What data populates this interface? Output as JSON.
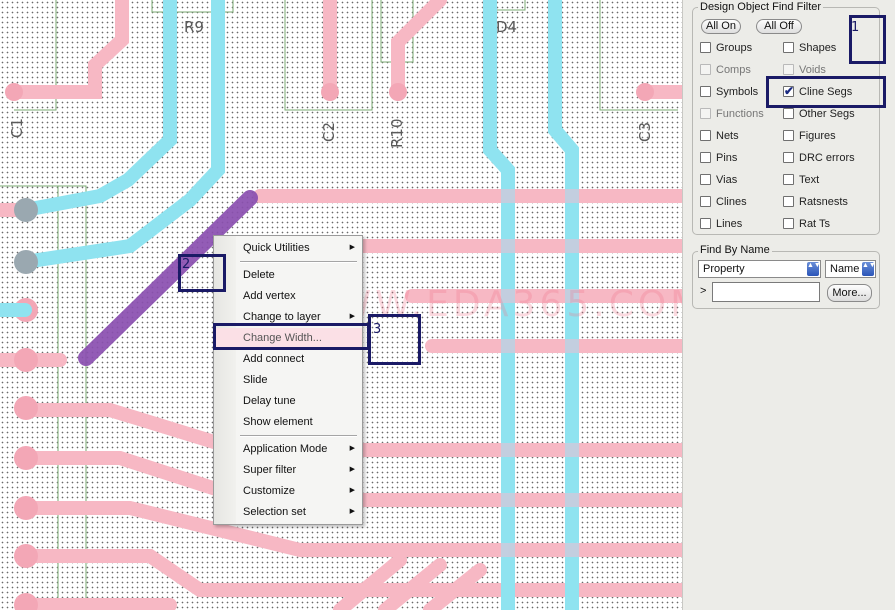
{
  "canvas": {
    "refdes": [
      "R9",
      "D4",
      "C1",
      "C2",
      "R10",
      "C3"
    ],
    "watermark": "WWW.EDA365.COM"
  },
  "context_menu": {
    "items": [
      {
        "label": "Quick Utilities",
        "submenu": true
      },
      {
        "label": "Delete",
        "submenu": false
      },
      {
        "label": "Add vertex",
        "submenu": false
      },
      {
        "label": "Change to layer",
        "submenu": true
      },
      {
        "label": "Change Width...",
        "submenu": false,
        "highlighted": true
      },
      {
        "label": "Add connect",
        "submenu": false
      },
      {
        "label": "Slide",
        "submenu": false
      },
      {
        "label": "Delay tune",
        "submenu": false
      },
      {
        "label": "Show element",
        "submenu": false
      },
      {
        "label": "Application Mode",
        "submenu": true
      },
      {
        "label": "Super filter",
        "submenu": true
      },
      {
        "label": "Customize",
        "submenu": true
      },
      {
        "label": "Selection set",
        "submenu": true
      }
    ],
    "submenu_arrow": "▶"
  },
  "annotations": {
    "one": "1",
    "two": "2",
    "three": "3"
  },
  "find_filter": {
    "title": "Design Object Find Filter",
    "all_on": "All On",
    "all_off": "All Off",
    "left": [
      {
        "label": "Groups",
        "checked": false,
        "enabled": true
      },
      {
        "label": "Comps",
        "checked": false,
        "enabled": false
      },
      {
        "label": "Symbols",
        "checked": false,
        "enabled": true
      },
      {
        "label": "Functions",
        "checked": false,
        "enabled": false
      },
      {
        "label": "Nets",
        "checked": false,
        "enabled": true
      },
      {
        "label": "Pins",
        "checked": false,
        "enabled": true
      },
      {
        "label": "Vias",
        "checked": false,
        "enabled": true
      },
      {
        "label": "Clines",
        "checked": false,
        "enabled": true
      },
      {
        "label": "Lines",
        "checked": false,
        "enabled": true
      }
    ],
    "right": [
      {
        "label": "Shapes",
        "checked": false,
        "enabled": true
      },
      {
        "label": "Voids",
        "checked": false,
        "enabled": false
      },
      {
        "label": "Cline Segs",
        "checked": true,
        "enabled": true
      },
      {
        "label": "Other Segs",
        "checked": false,
        "enabled": true
      },
      {
        "label": "Figures",
        "checked": false,
        "enabled": true
      },
      {
        "label": "DRC errors",
        "checked": false,
        "enabled": true
      },
      {
        "label": "Text",
        "checked": false,
        "enabled": true
      },
      {
        "label": "Ratsnests",
        "checked": false,
        "enabled": true
      },
      {
        "label": "Rat Ts",
        "checked": false,
        "enabled": true
      }
    ],
    "check_mark": "✔"
  },
  "find_by_name": {
    "title": "Find By Name",
    "type_value": "Property",
    "field_value": "Name",
    "prompt": ">",
    "more_button": "More...",
    "drop_glyph": "▲▼"
  },
  "colors": {
    "pink_trace": "#f7b8c4",
    "cyan_trace": "#8fe3f0",
    "selected_trace": "#8a4fb0",
    "annotation": "#1a1a66"
  }
}
